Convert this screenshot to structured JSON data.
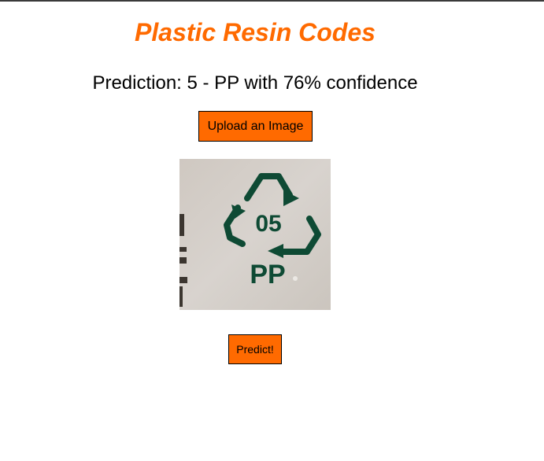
{
  "app": {
    "title": "Plastic Resin Codes",
    "prediction_text": "Prediction: 5 - PP with 76% confidence",
    "upload_button_label": "Upload an Image",
    "predict_button_label": "Predict!"
  },
  "image": {
    "code_text": "05",
    "resin_text": "PP",
    "symbol_color": "#0e4a34"
  },
  "colors": {
    "accent": "#ff6a00",
    "text": "#000000",
    "background": "#ffffff"
  }
}
